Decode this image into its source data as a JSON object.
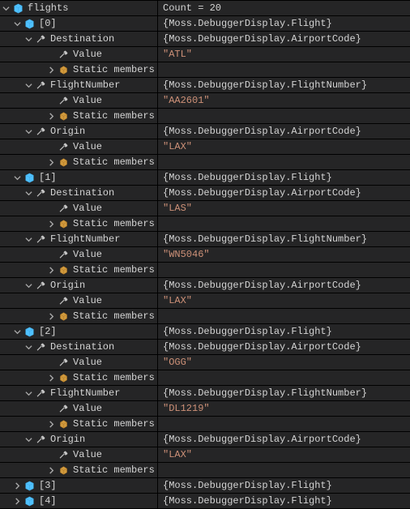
{
  "root": {
    "name": "flights",
    "value": "Count = 20"
  },
  "flight_type": "{Moss.DebuggerDisplay.Flight}",
  "airport_type": "{Moss.DebuggerDisplay.AirportCode}",
  "flightnum_type": "{Moss.DebuggerDisplay.FlightNumber}",
  "labels": {
    "destination": "Destination",
    "flightnumber": "FlightNumber",
    "origin": "Origin",
    "value": "Value",
    "static": "Static members"
  },
  "items": [
    {
      "idx": "[0]",
      "dest": "\"ATL\"",
      "num": "\"AA2601\"",
      "orig": "\"LAX\""
    },
    {
      "idx": "[1]",
      "dest": "\"LAS\"",
      "num": "\"WN5046\"",
      "orig": "\"LAX\""
    },
    {
      "idx": "[2]",
      "dest": "\"OGG\"",
      "num": "\"DL1219\"",
      "orig": "\"LAX\""
    }
  ],
  "collapsed": [
    "[3]",
    "[4]"
  ]
}
